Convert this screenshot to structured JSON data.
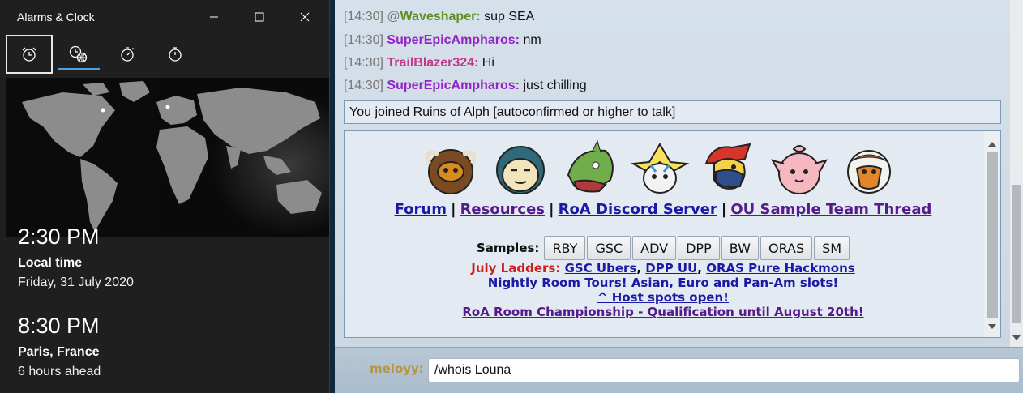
{
  "clock_app": {
    "title": "Alarms & Clock",
    "nav_tabs": [
      "alarm",
      "world-clock",
      "timer",
      "stopwatch"
    ],
    "accent_color": "#4aa3df",
    "local": {
      "time": "2:30 PM",
      "place": "Local time",
      "detail": "Friday, 31 July 2020"
    },
    "paris": {
      "time": "8:30 PM",
      "place": "Paris, France",
      "detail": "6 hours ahead"
    }
  },
  "chat": {
    "lines": [
      {
        "time": "[14:30]",
        "prefix": "@",
        "user": "Waveshaper:",
        "user_color": "#5e8f1f",
        "message": "sup SEA"
      },
      {
        "time": "[14:30]",
        "prefix": "",
        "user": "SuperEpicAmpharos:",
        "user_color": "#9324c7",
        "message": "nm"
      },
      {
        "time": "[14:30]",
        "prefix": "",
        "user": "TrailBlazer324:",
        "user_color": "#c23a8a",
        "message": "Hi"
      },
      {
        "time": "[14:30]",
        "prefix": "",
        "user": "SuperEpicAmpharos:",
        "user_color": "#9324c7",
        "message": "just chilling"
      }
    ],
    "join_notice": "You joined Ruins of Alph [autoconfirmed or higher to talk]"
  },
  "roomintro": {
    "links": {
      "forum": "Forum",
      "resources": "Resources",
      "discord": "RoA Discord Server",
      "ou_thread": "OU Sample Team Thread",
      "separator": "|"
    },
    "samples_label": "Samples:",
    "tiers": [
      "RBY",
      "GSC",
      "ADV",
      "DPP",
      "BW",
      "ORAS",
      "SM"
    ],
    "ladders_label": "July Ladders:",
    "ladders": [
      "GSC Ubers",
      "DPP UU",
      "ORAS Pure Hackmons"
    ],
    "tours": "Nightly Room Tours! Asian, Euro and Pan-Am slots!",
    "host": "^ Host spots open!",
    "championship": "RoA Room Championship - Qualification until August 20th!"
  },
  "chatbox": {
    "username": "meloyy:",
    "input_value": "/whois Louna"
  }
}
